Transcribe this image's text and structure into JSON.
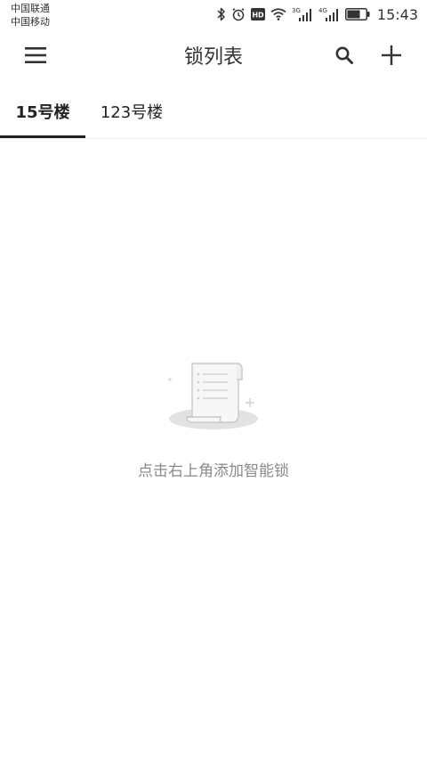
{
  "status_bar": {
    "carrier_1": "中国联通",
    "carrier_2": "中国移动",
    "network_1": "3G",
    "network_2": "4G",
    "hd_label": "HD",
    "time": "15:43",
    "battery_percent": 70,
    "icons": [
      "bluetooth-icon",
      "alarm-icon",
      "hd-icon",
      "wifi-icon",
      "signal-3g-icon",
      "signal-4g-icon",
      "battery-icon"
    ]
  },
  "app_bar": {
    "title": "锁列表",
    "icons": [
      "menu-icon",
      "search-icon",
      "add-icon"
    ]
  },
  "tabs": [
    {
      "label": "15号楼",
      "selected": true
    },
    {
      "label": "123号楼",
      "selected": false
    }
  ],
  "empty_state": {
    "message": "点击右上角添加智能锁",
    "icon": "empty-document-icon"
  },
  "colors": {
    "text_primary": "#222222",
    "text_secondary": "#8a8a8a",
    "background": "#ffffff",
    "divider": "#eeeeee"
  }
}
